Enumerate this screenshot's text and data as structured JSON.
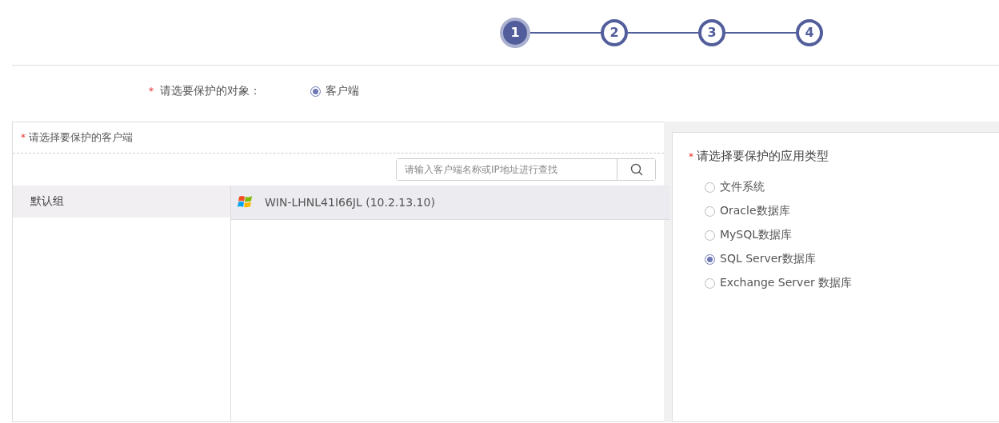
{
  "steps": [
    {
      "label": "1",
      "selected": true
    },
    {
      "label": "2",
      "selected": false
    },
    {
      "label": "3",
      "selected": false
    },
    {
      "label": "4",
      "selected": false
    }
  ],
  "protect_target": {
    "required_mark": "*",
    "label": "请选要保护的对象：",
    "options": [
      {
        "label": "客户端",
        "selected": true
      }
    ]
  },
  "client_panel": {
    "required_mark": "*",
    "title": "请选择要保护的客户端",
    "search": {
      "placeholder": "请输入客户端名称或IP地址进行查找"
    },
    "groups": [
      {
        "label": "默认组",
        "selected": true
      }
    ],
    "clients": [
      {
        "label": "WIN-LHNL41I66JL (10.2.13.10)",
        "selected": true
      }
    ]
  },
  "app_panel": {
    "required_mark": "*",
    "title": "请选择要保护的应用类型",
    "options": [
      {
        "label": "文件系统",
        "selected": false
      },
      {
        "label": "Oracle数据库",
        "selected": false
      },
      {
        "label": "MySQL数据库",
        "selected": false
      },
      {
        "label": "SQL Server数据库",
        "selected": true
      },
      {
        "label": "Exchange Server 数据库",
        "selected": false
      }
    ]
  }
}
